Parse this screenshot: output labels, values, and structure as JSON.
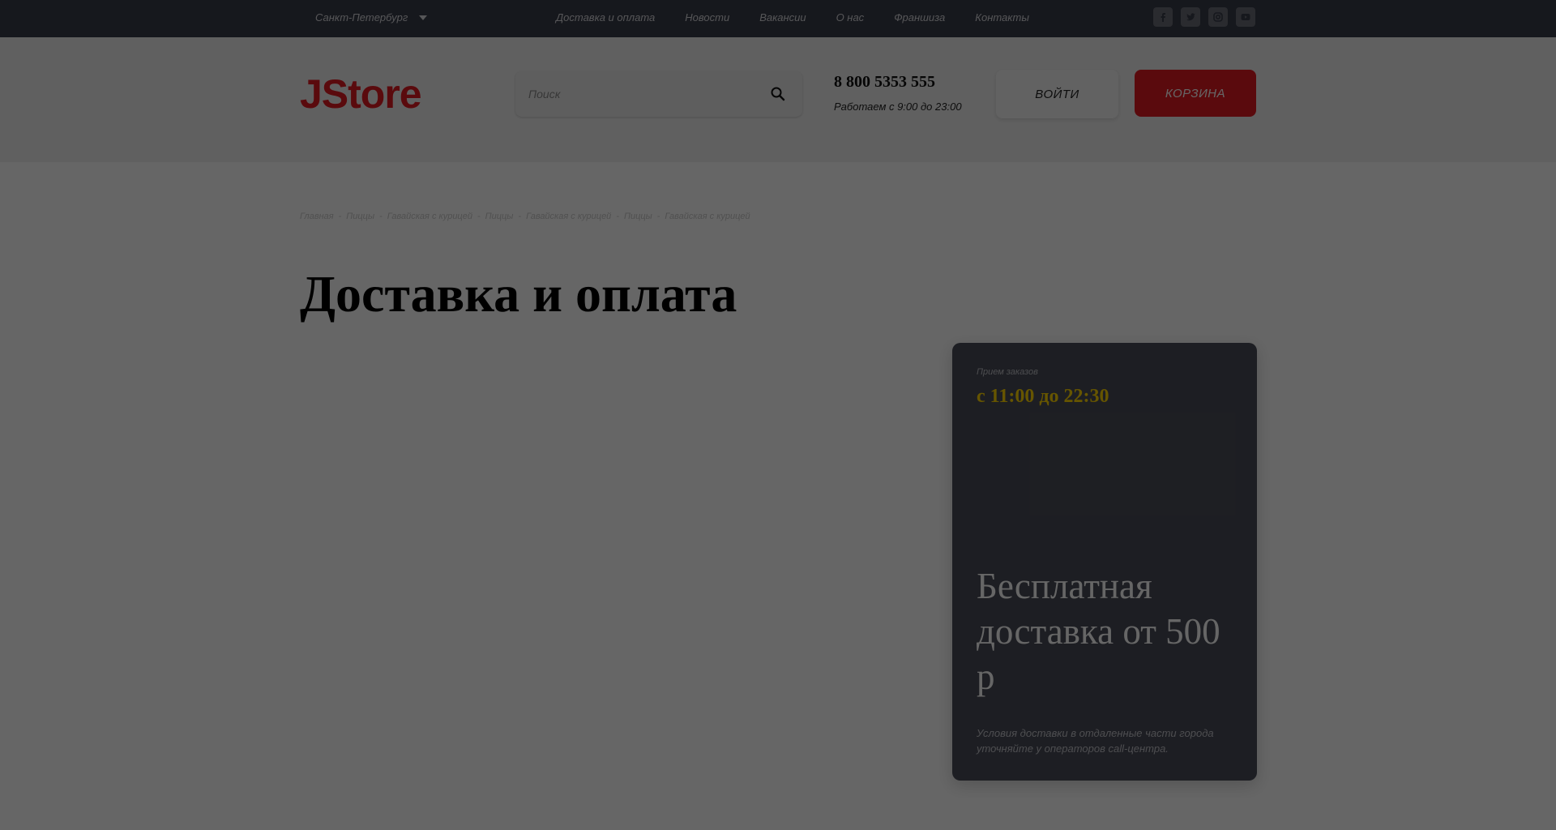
{
  "topbar": {
    "city": "Санкт-Петербург",
    "nav": [
      "Доставка и оплата",
      "Новости",
      "Вакансии",
      "О нас",
      "Франшиза",
      "Контакты"
    ],
    "socials": [
      "facebook-icon",
      "twitter-icon",
      "instagram-icon",
      "youtube-icon"
    ]
  },
  "header": {
    "logo": "JStore",
    "search": {
      "placeholder": "Поиск",
      "value": ""
    },
    "phone": "8 800 5353 555",
    "hours": "Работаем с 9:00 до 23:00",
    "login_label": "ВОЙТИ",
    "cart_label": "КОРЗИНА"
  },
  "breadcrumb": [
    "Главная",
    "Пиццы",
    "Гавайская с курицей",
    "Пиццы",
    "Гавайская с курицей",
    "Пиццы",
    "Гавайская с курицей"
  ],
  "page": {
    "title": "Доставка и оплата"
  },
  "card": {
    "label": "Прием заказов",
    "time": "с 11:00 до 22:30",
    "promo": "Бесплатная доставка от 500 р",
    "note": "Условия доставки в отдаленные части города уточняйте у операторов call-центра."
  },
  "colors": {
    "brand_red": "#e11b22",
    "topbar_bg": "#393c49",
    "card_bg": "#4a4d58",
    "accent_yellow": "#ffd400"
  }
}
